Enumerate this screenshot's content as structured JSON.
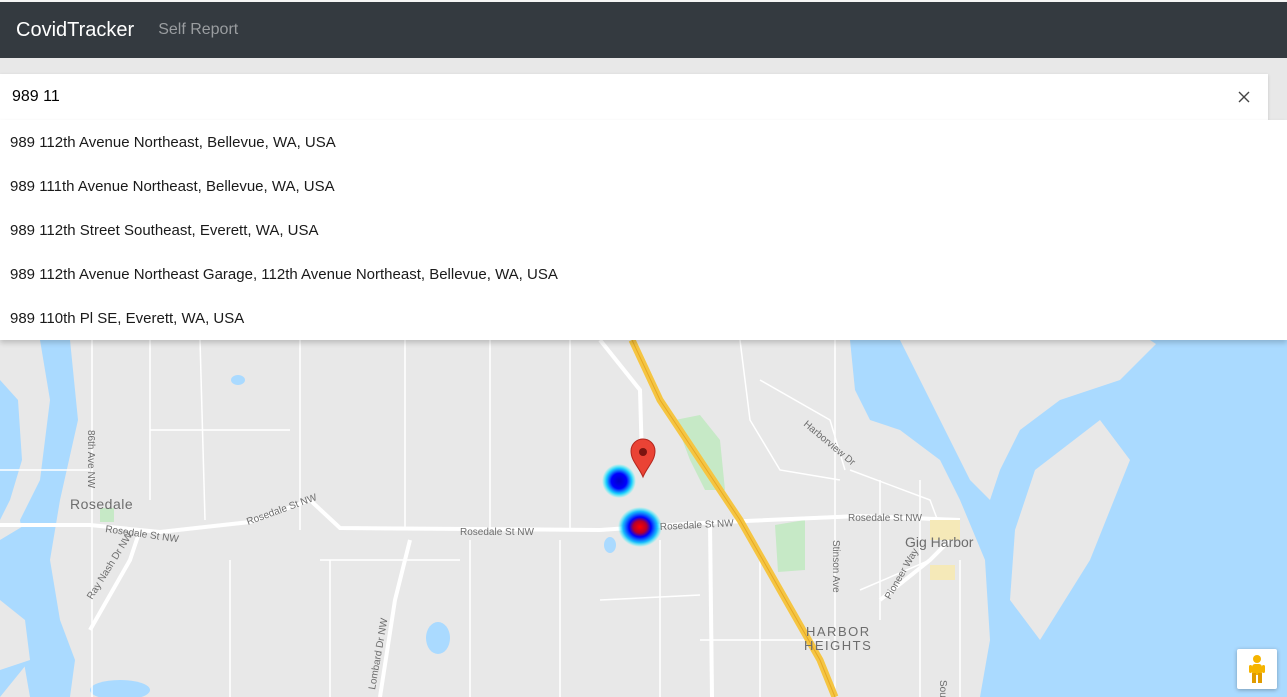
{
  "navbar": {
    "brand": "CovidTracker",
    "links": [
      "Self Report"
    ]
  },
  "search": {
    "value": "989 11",
    "suggestions": [
      "989 112th Avenue Northeast, Bellevue, WA, USA",
      "989 111th Avenue Northeast, Bellevue, WA, USA",
      "989 112th Street Southeast, Everett, WA, USA",
      "989 112th Avenue Northeast Garage, 112th Avenue Northeast, Bellevue, WA, USA",
      "989 110th Pl SE, Everett, WA, USA"
    ]
  },
  "map": {
    "labels": {
      "rosedale": "Rosedale",
      "gig_harbor": "Gig Harbor",
      "harbor": "HARBOR",
      "heights": "HEIGHTS",
      "rosedale_st_1": "Rosedale St NW",
      "rosedale_st_2": "Rosedale St NW",
      "rosedale_st_3": "Rosedale St NW",
      "rosedale_st_4": "Rosedale St NW",
      "rosedale_st_5": "Rosedale St NW",
      "ave_86th": "86th Ave NW",
      "ray_nash": "Ray Nash Dr NW",
      "lombard": "Lombard Dr NW",
      "harborview": "Harborview Dr",
      "stinson": "Stinson Ave",
      "pioneer": "Pioneer Way",
      "sou": "Sou"
    },
    "colors": {
      "water": "#aadaff",
      "land": "#e8e8e8",
      "park": "#c6e9c6",
      "highway": "#f5c542",
      "marker": "#ea4335"
    },
    "icons": {
      "marker": "map-pin-icon",
      "pegman": "street-view-pegman-icon",
      "clear": "close-icon"
    }
  }
}
